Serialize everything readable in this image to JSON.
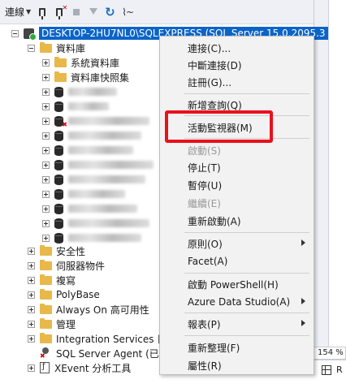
{
  "toolbar": {
    "connect_label": "連線",
    "icons": [
      "connect-icon",
      "disconnect-icon",
      "stop-icon",
      "filter-icon",
      "refresh-icon",
      "activity-icon"
    ]
  },
  "tree": {
    "server": "DESKTOP-2HU7NL0\\SQLEXPRESS (SQL Server 15.0.2095.3",
    "databases_folder": "資料庫",
    "system_databases": "系統資料庫",
    "snapshots": "資料庫快照集",
    "folders": [
      "安全性",
      "伺服器物件",
      "複寫",
      "PolyBase",
      "Always On 高可用性",
      "管理",
      "Integration Services 目"
    ],
    "agent": "SQL Server Agent (已停",
    "xevent": "XEvent 分析工具"
  },
  "context_menu": {
    "items": [
      {
        "label": "連接(C)...",
        "enabled": true
      },
      {
        "label": "中斷連接(D)",
        "enabled": true
      },
      {
        "label": "註冊(G)...",
        "enabled": true
      },
      {
        "label": "新增查詢(Q)",
        "enabled": true
      },
      {
        "label": "活動監視器(M)",
        "enabled": true
      },
      {
        "label": "啟動(S)",
        "enabled": false
      },
      {
        "label": "停止(T)",
        "enabled": true
      },
      {
        "label": "暫停(U)",
        "enabled": true
      },
      {
        "label": "繼續(E)",
        "enabled": false
      },
      {
        "label": "重新啟動(A)",
        "enabled": true
      },
      {
        "label": "原則(O)",
        "enabled": true
      },
      {
        "label": "Facet(A)",
        "enabled": true
      },
      {
        "label": "啟動 PowerShell(H)",
        "enabled": true
      },
      {
        "label": "Azure Data Studio(A)",
        "enabled": true
      },
      {
        "label": "報表(P)",
        "enabled": true
      },
      {
        "label": "重新整理(F)",
        "enabled": true
      },
      {
        "label": "屬性(R)",
        "enabled": true
      }
    ]
  },
  "status": {
    "zoom": "154 %",
    "grid_label": "R"
  },
  "colors": {
    "selection": "#0a64c8",
    "highlight_box": "#e8111b",
    "menu_bg": "#f2f2f2"
  }
}
